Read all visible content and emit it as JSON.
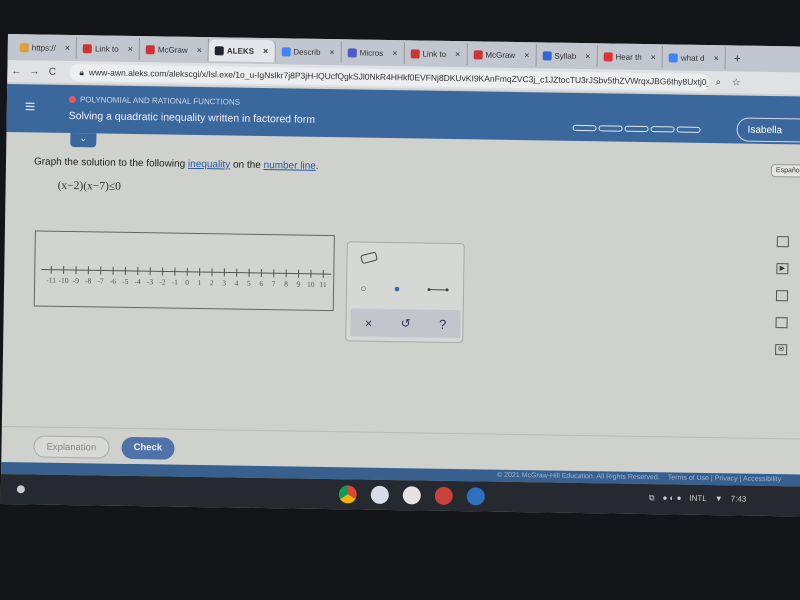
{
  "browser": {
    "tabs": [
      {
        "label": "https://",
        "color": "#e0a030",
        "active": false
      },
      {
        "label": "Link to",
        "color": "#c33",
        "active": false
      },
      {
        "label": "McGraw",
        "color": "#c33",
        "active": false
      },
      {
        "label": "ALEKS",
        "color": "#223",
        "active": true
      },
      {
        "label": "Describ",
        "color": "#4285f4",
        "active": false
      },
      {
        "label": "Micros",
        "color": "#5059c9",
        "active": false
      },
      {
        "label": "Link to",
        "color": "#c33",
        "active": false
      },
      {
        "label": "McGraw",
        "color": "#c33",
        "active": false
      },
      {
        "label": "Syllab",
        "color": "#3367d6",
        "active": false
      },
      {
        "label": "Hear th",
        "color": "#d33",
        "active": false
      },
      {
        "label": "what d",
        "color": "#4285f4",
        "active": false
      }
    ],
    "close": "×",
    "new_tab": "+",
    "url": "www-awn.aleks.com/alekscgi/x/Isl.exe/1o_u-IgNslkr7j8P3jH-lQUcfQgkSJl0NkR4HHkf0EVFNj8DKUvKI9KAnFmqZVC3j_c1JZtocTU3rJSbv5thZVWrqxJBG6thy8Uxtj0_y..."
  },
  "header": {
    "menu_icon": "≡",
    "topic": "POLYNOMIAL AND RATIONAL FUNCTIONS",
    "title": "Solving a quadratic inequality written in factored form",
    "user": "Isabella",
    "progress_segments": 5,
    "chevron": "⌄"
  },
  "espanol": "Español",
  "question": {
    "prefix": "Graph the solution to the following ",
    "link1": "inequality",
    "middle": " on the ",
    "link2": "number line",
    "suffix": ".",
    "expression": "(x−2)(x−7)≤0"
  },
  "number_line": {
    "min": -11,
    "max": 11,
    "labels": [
      "-11",
      "-10",
      "-9",
      "-8",
      "-7",
      "-6",
      "-5",
      "-4",
      "-3",
      "-2",
      "-1",
      "0",
      "1",
      "2",
      "3",
      "4",
      "5",
      "6",
      "7",
      "8",
      "9",
      "10",
      "11"
    ]
  },
  "tools": {
    "eraser": "eraser-icon",
    "open_point": "○",
    "closed_point": "●",
    "segment": "segment-icon",
    "clear": "×",
    "undo": "↺",
    "help": "?"
  },
  "buttons": {
    "explanation": "Explanation",
    "check": "Check"
  },
  "footer": {
    "copyright": "© 2021 McGraw-Hill Education. All Rights Reserved.",
    "terms": "Terms of Use",
    "privacy": "Privacy",
    "accessibility": "Accessibility",
    "sep": "|"
  },
  "taskbar": {
    "locale": "INTL",
    "time": "7:43"
  }
}
